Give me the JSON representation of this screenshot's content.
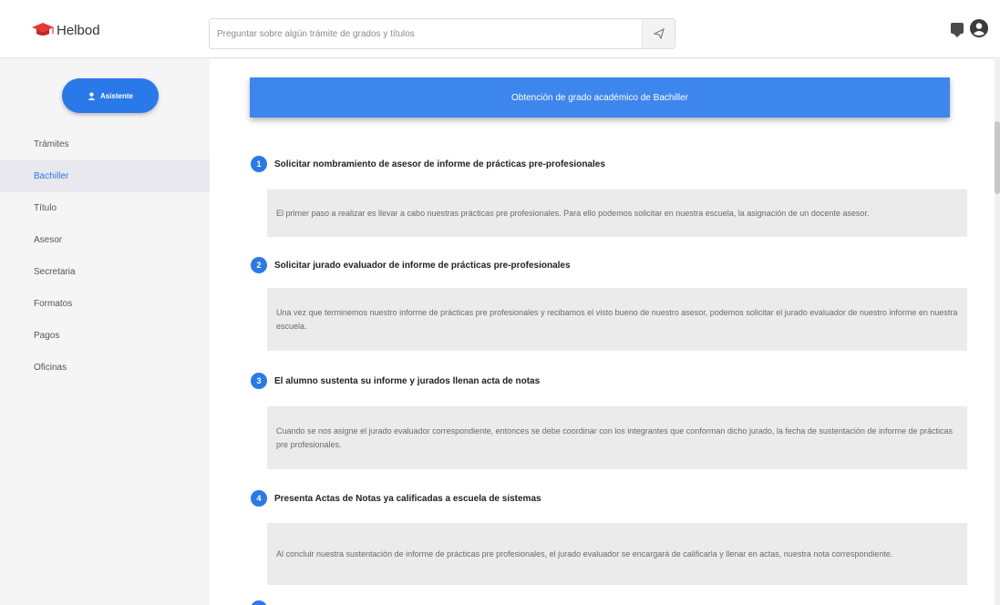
{
  "brand": {
    "name": "Helbod",
    "accent": "#2a79e9",
    "cap_color": "#e53935"
  },
  "search": {
    "placeholder": "Preguntar sobre algún trámite de grados y títulos",
    "button_icon": "send-icon"
  },
  "header_icons": [
    "message-icon",
    "user-circle-icon"
  ],
  "sidebar": {
    "assist_label": "Asistente",
    "items": [
      {
        "label": "Trámites"
      },
      {
        "label": "Bachiller"
      },
      {
        "label": "Título"
      },
      {
        "label": "Asesor"
      },
      {
        "label": "Secretaria"
      },
      {
        "label": "Formatos"
      },
      {
        "label": "Pagos"
      },
      {
        "label": "Oficinas"
      }
    ],
    "active_index": 1
  },
  "main": {
    "banner": "Obtención de grado académico de Bachiller",
    "steps": [
      {
        "num": "1",
        "title": "Solicitar nombramiento de asesor de informe de prácticas pre-profesionales",
        "text": "El primer paso a realizar es llevar a cabo nuestras prácticas pre profesionales. Para ello podemos solicitar en nuestra escuela, la asignación de un docente asesor."
      },
      {
        "num": "2",
        "title": "Solicitar jurado evaluador de informe de prácticas pre-profesionales",
        "text": "Una vez que terminemos nuestro informe de prácticas pre profesionales y recibamos el visto bueno de nuestro asesor, podemos solicitar el jurado evaluador de nuestro informe en nuestra escuela."
      },
      {
        "num": "3",
        "title": "El alumno sustenta su informe y jurados llenan acta de notas",
        "text": "Cuando se nos asigne el jurado evaluador correspondiente, entonces se debe coordinar con los integrantes que conforman dicho jurado, la fecha de sustentación de informe de prácticas pre profesionales."
      },
      {
        "num": "4",
        "title": "Presenta Actas de Notas ya calificadas a escuela de sistemas",
        "text": "Al concluir nuestra sustentación de informe de prácticas pre profesionales, el jurado evaluador se encargará de calificarla y llenar en actas, nuestra nota correspondiente."
      }
    ]
  }
}
